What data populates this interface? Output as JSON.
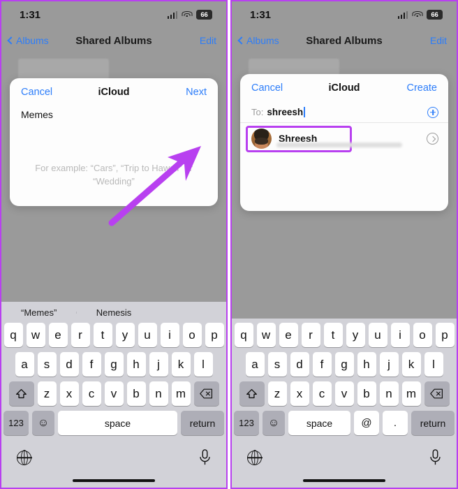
{
  "panels": [
    {
      "id": "left",
      "status": {
        "time": "1:31",
        "battery": "66",
        "signal_icon": "cellular-signal-icon",
        "wifi_icon": "wifi-icon",
        "battery_icon": "battery-icon"
      },
      "nav": {
        "back_label": "Albums",
        "title": "Shared Albums",
        "edit_label": "Edit",
        "back_icon": "chevron-left-icon"
      },
      "sheet": {
        "cancel_label": "Cancel",
        "title": "iCloud",
        "action_label": "Next",
        "album_name": "Memes",
        "hint": "For example: “Cars”, “Trip to Hawaii” or “Wedding”"
      },
      "annotation": {
        "arrow_icon": "arrow-pointing-to-next-icon",
        "color": "#b840f0"
      },
      "keyboard": {
        "has_suggestions": true,
        "suggestions": [
          "“Memes”",
          "Nemesis",
          ""
        ],
        "row1": [
          "q",
          "w",
          "e",
          "r",
          "t",
          "y",
          "u",
          "i",
          "o",
          "p"
        ],
        "row2": [
          "a",
          "s",
          "d",
          "f",
          "g",
          "h",
          "j",
          "k",
          "l"
        ],
        "row3": [
          "z",
          "x",
          "c",
          "v",
          "b",
          "n",
          "m"
        ],
        "shift_icon": "shift-arrow-icon",
        "delete_icon": "backspace-icon",
        "numbers_label": "123",
        "emoji_icon": "emoji-smiley-icon",
        "space_label": "space",
        "return_label": "return",
        "extra_keys": [],
        "globe_icon": "globe-language-icon",
        "mic_icon": "microphone-icon"
      }
    },
    {
      "id": "right",
      "status": {
        "time": "1:31",
        "battery": "66",
        "signal_icon": "cellular-signal-icon",
        "wifi_icon": "wifi-icon",
        "battery_icon": "battery-icon"
      },
      "nav": {
        "back_label": "Albums",
        "title": "Shared Albums",
        "edit_label": "Edit",
        "back_icon": "chevron-left-icon"
      },
      "sheet": {
        "cancel_label": "Cancel",
        "title": "iCloud",
        "action_label": "Create",
        "to_label": "To:",
        "to_value": "shreesh",
        "add_contact_icon": "plus-circle-icon",
        "suggestion_name": "Shreesh",
        "avatar_icon": "contact-avatar",
        "detail_icon": "chevron-right-circle-icon"
      },
      "annotation": {
        "highlight_icon": "highlight-box",
        "color": "#b840f0"
      },
      "keyboard": {
        "has_suggestions": false,
        "suggestions": [],
        "row1": [
          "q",
          "w",
          "e",
          "r",
          "t",
          "y",
          "u",
          "i",
          "o",
          "p"
        ],
        "row2": [
          "a",
          "s",
          "d",
          "f",
          "g",
          "h",
          "j",
          "k",
          "l"
        ],
        "row3": [
          "z",
          "x",
          "c",
          "v",
          "b",
          "n",
          "m"
        ],
        "shift_icon": "shift-arrow-icon",
        "delete_icon": "backspace-icon",
        "numbers_label": "123",
        "emoji_icon": "emoji-smiley-icon",
        "space_label": "space",
        "return_label": "return",
        "extra_keys": [
          "@",
          "."
        ],
        "globe_icon": "globe-language-icon",
        "mic_icon": "microphone-icon"
      }
    }
  ]
}
